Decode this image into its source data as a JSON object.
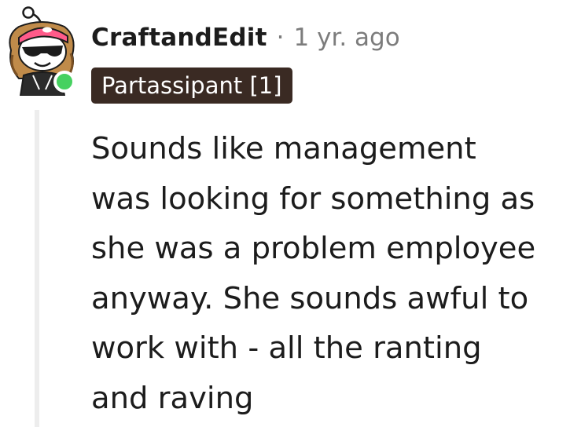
{
  "comment": {
    "author": "CraftandEdit",
    "separator": "·",
    "age": "1 yr. ago",
    "flair": "Partassipant [1]",
    "body_lines": [
      "Sounds like management",
      "was looking for something as",
      "she was a problem employee",
      "anyway. She sounds awful to",
      "work with - all the ranting",
      "and raving"
    ],
    "online_status": "online",
    "avatar_icon": "snoo-avatar-icon"
  },
  "colors": {
    "flair_bg": "#3a2a23",
    "online": "#46d160",
    "muted_text": "#7c7c7c",
    "thread_line": "#ededed"
  }
}
